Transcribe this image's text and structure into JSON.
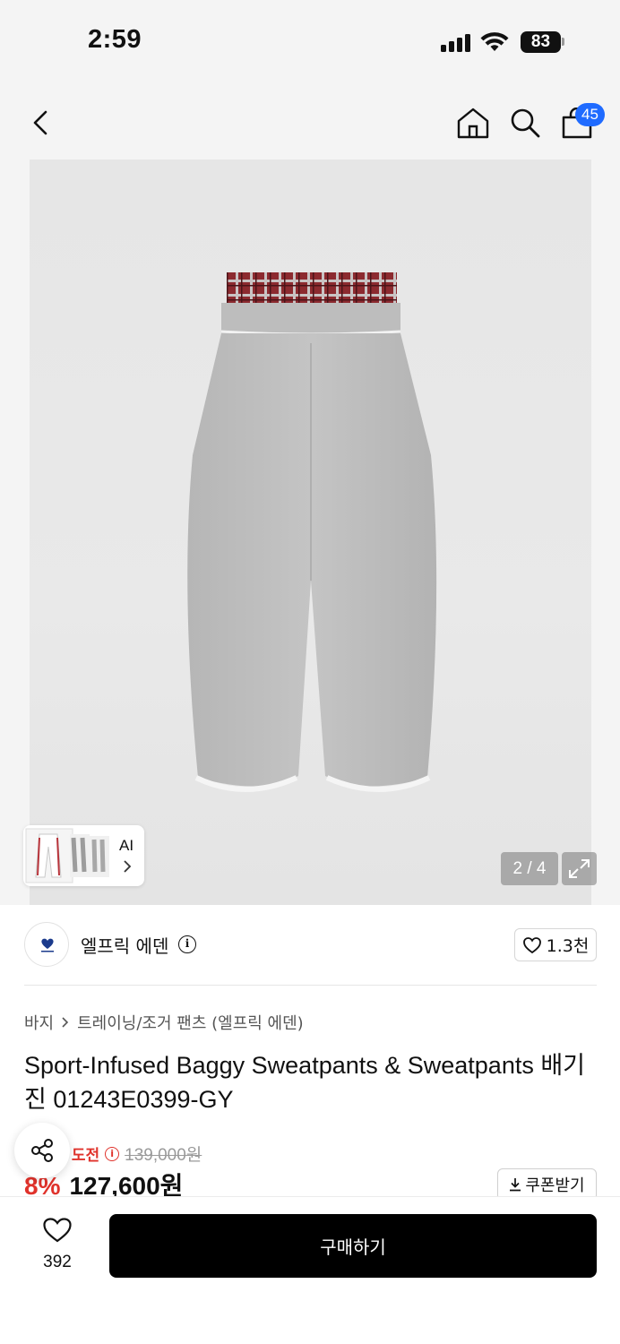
{
  "status_bar": {
    "time": "2:59",
    "battery": "83"
  },
  "header": {
    "cart_count": "45"
  },
  "gallery": {
    "ai_label": "AI",
    "page_indicator": "2 / 4"
  },
  "brand": {
    "name": "엘프릭 에덴",
    "likes": "1.3천"
  },
  "breadcrumb": [
    "바지",
    "트레이닝/조거 팬츠 (엘프릭 에덴)"
  ],
  "product": {
    "title": "Sport-Infused Baggy Sweatpants & Sweatpants 배기 진 01243E0399-GY",
    "challenge_label": "최저가 도전",
    "original_price": "139,000원",
    "discount": "8%",
    "final_price": "127,600원",
    "coupon_label": "쿠폰받기"
  },
  "bottom": {
    "wish_count": "392",
    "buy_label": "구매하기"
  },
  "colors": {
    "accent_red": "#e0322b",
    "badge_blue": "#1f6bff",
    "primary": "#000000"
  }
}
